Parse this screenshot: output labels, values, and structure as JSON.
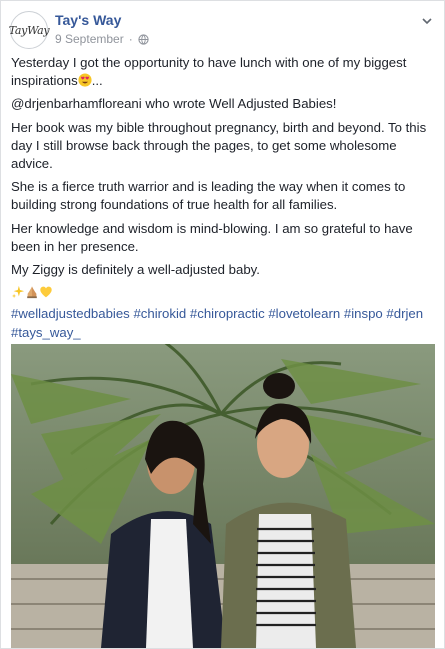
{
  "post": {
    "page_name": "Tay's Way",
    "avatar_text": "TayWay",
    "date": "9 September",
    "separator": "·",
    "paragraphs": [
      "Yesterday I got the opportunity to have lunch with one of my biggest inspirations",
      "@drjenbarhamfloreani who wrote Well Adjusted Babies!",
      "Her book was my bible throughout pregnancy, birth and beyond. To this day I still browse back through the pages, to get some wholesome advice.",
      "She is a fierce truth warrior and is leading the way when it comes to building strong foundations of true health for all families.",
      "Her knowledge and wisdom is mind-blowing. I am so grateful to have been in her presence.",
      "My Ziggy is definitely a well-adjusted baby."
    ],
    "ellipsis": "...",
    "emoji_line_icons": [
      "sparkles-emoji",
      "praying-hands-emoji",
      "yellow-heart-emoji"
    ],
    "hashtags": [
      "#welladjustedbabies",
      "#chirokid",
      "#chiropractic",
      "#lovetolearn",
      "#inspo",
      "#drjen",
      "#tays_way_"
    ]
  },
  "colors": {
    "link": "#365899",
    "text": "#1d2129",
    "meta": "#90949c",
    "border": "#dddfe2"
  },
  "photo": {
    "subject": "two-women-posing-in-front-of-palm"
  }
}
